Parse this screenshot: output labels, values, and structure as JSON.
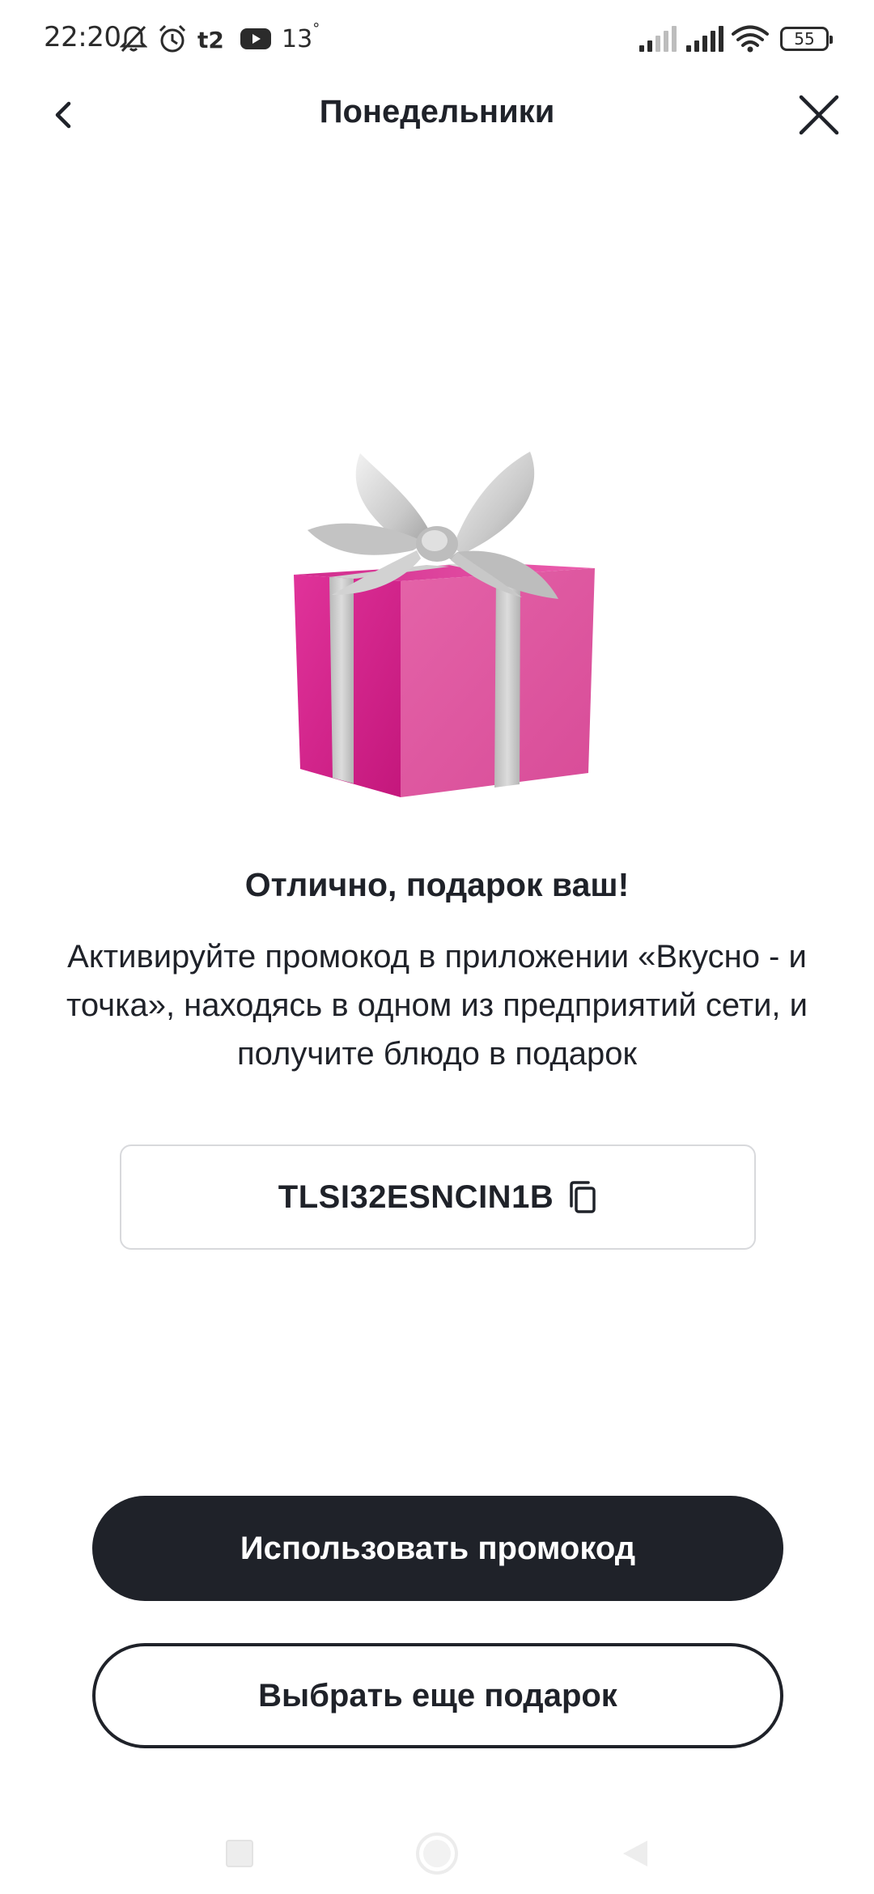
{
  "status_bar": {
    "time": "22:20",
    "temperature": "13",
    "temperature_unit": "°",
    "battery": "55",
    "icons": [
      "bell-off-icon",
      "alarm-icon",
      "t2-carrier-icon",
      "youtube-icon",
      "signal-icon",
      "signal-icon",
      "wifi-icon",
      "battery-icon"
    ]
  },
  "header": {
    "title": "Понедельники",
    "back_icon": "chevron-left-icon",
    "close_icon": "close-icon"
  },
  "content": {
    "image": "gift-box",
    "title": "Отлично, подарок ваш!",
    "description": "Активируйте промокод в приложении «Вкусно - и точка», находясь в одном из предприятий сети, и получите блюдо в подарок",
    "promo_code": "TLSI32ESNCIN1B",
    "copy_icon": "copy-icon"
  },
  "actions": {
    "primary_label": "Использовать промокод",
    "secondary_label": "Выбрать еще подарок"
  },
  "navigation": {
    "icons": [
      "recents-square-icon",
      "home-circle-icon",
      "back-triangle-icon"
    ]
  },
  "colors": {
    "dark": "#1f2229",
    "gift_pink": "#e0339a",
    "ribbon_silver": "#c9c9c9",
    "border": "#d8d9dc"
  }
}
